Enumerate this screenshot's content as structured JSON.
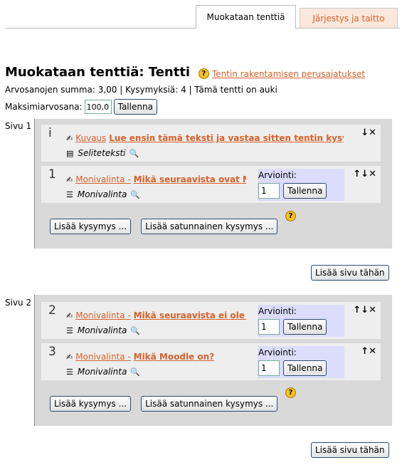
{
  "tabs": {
    "edit": "Muokataan tenttiä",
    "order": "Järjestys ja taitto"
  },
  "title": "Muokataan tenttiä: Tentti",
  "help_link": "Tentin rakentamisen perusajatukset",
  "summary": "Arvosanojen summa: 3,00 | Kysymyksiä: 4 | Tämä tentti on auki",
  "max_grade": {
    "label": "Maksimiarvosana:",
    "value": "100,00",
    "save": "Tallenna"
  },
  "pages": [
    {
      "label": "Sivu 1",
      "questions": [
        {
          "num": "i",
          "type": "Kuvaus",
          "title": "Lue ensin tämä teksti ja vastaa sitten tentin kysymyksiin",
          "subtype": "Seliteteksti",
          "icon": "description-icon",
          "controls": "↓✕"
        },
        {
          "num": "1",
          "type": "Monivalinta -",
          "title": "Mikä seuraavista ovat Moodlen",
          "subtype": "Monivalinta",
          "icon": "multichoice-icon",
          "controls": "↑↓✕",
          "grading": {
            "label": "Arviointi:",
            "value": "1",
            "save": "Tallenna"
          }
        }
      ],
      "add_question": "Lisää kysymys ...",
      "add_random": "Lisää satunnainen kysymys ..."
    },
    {
      "label": "Sivu 2",
      "questions": [
        {
          "num": "2",
          "type": "Monivalinta -",
          "title": "Mikä seuraavista ei ole Moodle",
          "subtype": "Monivalinta",
          "icon": "multichoice-icon",
          "controls": "↑↓✕",
          "grading": {
            "label": "Arviointi:",
            "value": "1",
            "save": "Tallenna"
          }
        },
        {
          "num": "3",
          "type": "Monivalinta -",
          "title": "Mikä Moodle on?",
          "subtype": "Monivalinta",
          "icon": "multichoice-icon",
          "controls": "↑✕",
          "grading": {
            "label": "Arviointi:",
            "value": "1",
            "save": "Tallenna"
          }
        }
      ],
      "add_question": "Lisää kysymys ...",
      "add_random": "Lisää satunnainen kysymys ..."
    }
  ],
  "add_page": "Lisää sivu tähän",
  "colors": {
    "link": "#d8612a",
    "page_bg": "#d9d9d9",
    "question_bg": "#eeeeee",
    "grade_bg": "#dcdcfc"
  }
}
